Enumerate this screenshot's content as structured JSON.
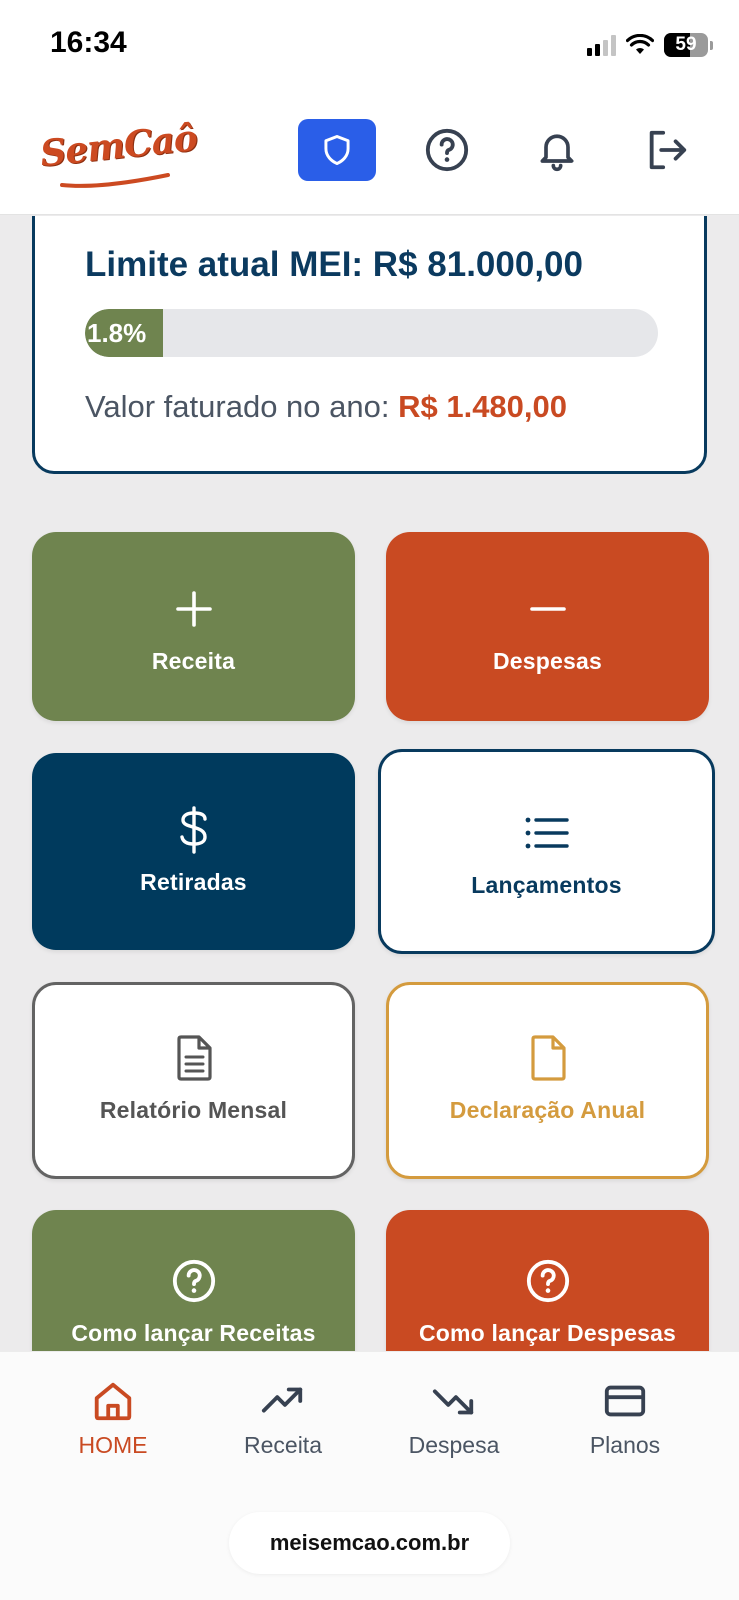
{
  "status": {
    "time": "16:34",
    "battery": "59"
  },
  "header": {
    "logo_text": "SemCaô",
    "icons": [
      "shield-icon",
      "help-circle-icon",
      "bell-icon",
      "logout-icon"
    ],
    "accent_color": "#2a5ee8"
  },
  "limit_card": {
    "title": "Limite atual MEI: R$ 81.000,00",
    "progress_label": "1.8%",
    "progress_fraction": 0.018,
    "faturado_label": "Valor faturado no ano: ",
    "faturado_value": "R$ 1.480,00"
  },
  "tiles": {
    "receita": {
      "label": "Receita",
      "icon": "plus-icon",
      "color": "#6f844f"
    },
    "despesas": {
      "label": "Despesas",
      "icon": "minus-icon",
      "color": "#c94a22"
    },
    "retiradas": {
      "label": "Retiradas",
      "icon": "dollar-icon",
      "color": "#003a5d"
    },
    "lancamentos": {
      "label": "Lançamentos",
      "icon": "list-icon",
      "color": "#083a5e"
    },
    "relatorio": {
      "label": "Relatório Mensal",
      "icon": "document-icon",
      "color": "#636363"
    },
    "declaracao": {
      "label": "Declaração Anual",
      "icon": "file-icon",
      "color": "#d49b3e"
    },
    "como_receitas": {
      "label": "Como lançar Receitas",
      "icon": "help-circle-icon",
      "color": "#6f844f"
    },
    "como_despesas": {
      "label": "Como lançar Despesas",
      "icon": "help-circle-icon",
      "color": "#c94a22"
    }
  },
  "bottom_nav": {
    "items": [
      {
        "label": "HOME",
        "icon": "home-icon",
        "active": true
      },
      {
        "label": "Receita",
        "icon": "trending-up-icon",
        "active": false
      },
      {
        "label": "Despesa",
        "icon": "trending-down-icon",
        "active": false
      },
      {
        "label": "Planos",
        "icon": "credit-card-icon",
        "active": false
      }
    ]
  },
  "browser": {
    "url": "meisemcao.com.br"
  }
}
